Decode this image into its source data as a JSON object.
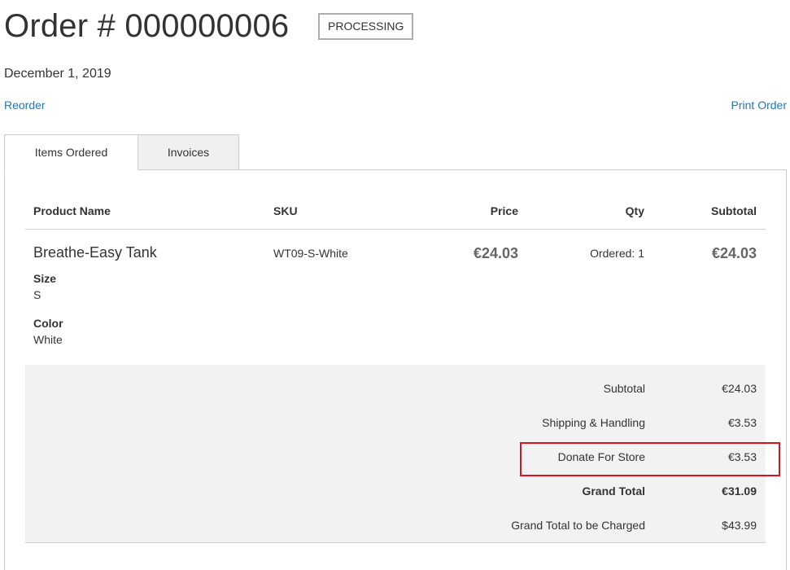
{
  "order": {
    "title": "Order # 000000006",
    "status": "PROCESSING",
    "date": "December 1, 2019"
  },
  "actions": {
    "reorder": "Reorder",
    "print_order": "Print Order"
  },
  "tabs": [
    {
      "label": "Items Ordered"
    },
    {
      "label": "Invoices"
    }
  ],
  "table": {
    "headers": {
      "product_name": "Product Name",
      "sku": "SKU",
      "price": "Price",
      "qty": "Qty",
      "subtotal": "Subtotal"
    },
    "items": [
      {
        "name": "Breathe-Easy Tank",
        "sku": "WT09-S-White",
        "price": "€24.03",
        "qty": "Ordered: 1",
        "subtotal": "€24.03",
        "options": [
          {
            "label": "Size",
            "value": "S"
          },
          {
            "label": "Color",
            "value": "White"
          }
        ]
      }
    ]
  },
  "totals": [
    {
      "label": "Subtotal",
      "value": "€24.03"
    },
    {
      "label": "Shipping & Handling",
      "value": "€3.53"
    },
    {
      "label": "Donate For Store",
      "value": "€3.53"
    },
    {
      "label": "Grand Total",
      "value": "€31.09"
    },
    {
      "label": "Grand Total to be Charged",
      "value": "$43.99"
    }
  ],
  "colors": {
    "link": "#1979c3",
    "highlight": "#e0101f",
    "totals_bg": "#f2f2f2"
  }
}
